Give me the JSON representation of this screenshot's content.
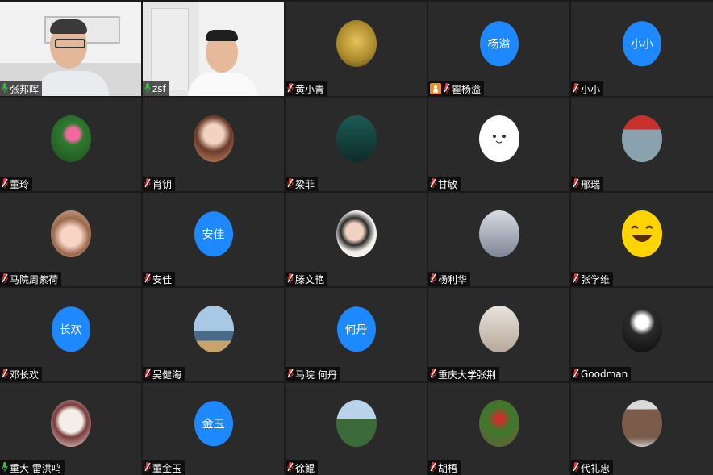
{
  "app": {
    "view": "gallery"
  },
  "colors": {
    "tile_bg": "#2a2a2a",
    "avatar_blue": "#1e88ff",
    "active_border": "#39b54a",
    "mic_muted": "#e53935",
    "mic_on": "#39b54a"
  },
  "participants": [
    {
      "name": "张邦晖",
      "type": "video",
      "mic": "on",
      "active": true,
      "avatar_icon": "man-with-glasses-video"
    },
    {
      "name": "zsf",
      "type": "video",
      "mic": "on",
      "avatar_icon": "man-video"
    },
    {
      "name": "黄小青",
      "type": "image",
      "mic": "muted",
      "avatar_icon": "golden-heart-avatar"
    },
    {
      "name": "瞿杨溢",
      "type": "text",
      "avatar_text": "杨溢",
      "mic": "muted",
      "hand_raised": true
    },
    {
      "name": "小小",
      "type": "text",
      "avatar_text": "小小",
      "mic": "muted"
    },
    {
      "name": "董玲",
      "type": "image",
      "mic": "muted",
      "avatar_icon": "lotus-flower-avatar"
    },
    {
      "name": "肖钥",
      "type": "image",
      "mic": "muted",
      "avatar_icon": "anime-girl-avatar"
    },
    {
      "name": " 梁菲",
      "type": "image",
      "mic": "muted",
      "avatar_icon": "girl-black-dress-avatar"
    },
    {
      "name": "甘敏",
      "type": "image",
      "mic": "muted",
      "avatar_icon": "white-blob-avatar"
    },
    {
      "name": "邢瑞",
      "type": "image",
      "mic": "muted",
      "avatar_icon": "umbrella-street-avatar"
    },
    {
      "name": "马院周紫荷",
      "type": "image",
      "mic": "muted",
      "avatar_icon": "cat-ears-girl-avatar"
    },
    {
      "name": "安佳",
      "type": "text",
      "avatar_text": "安佳",
      "mic": "muted"
    },
    {
      "name": "滕文艳",
      "type": "image",
      "mic": "muted",
      "avatar_icon": "child-with-heart-avatar"
    },
    {
      "name": "杨利华",
      "type": "image",
      "mic": "muted",
      "avatar_icon": "girl-portrait-avatar"
    },
    {
      "name": "张学维",
      "type": "image",
      "mic": "muted",
      "avatar_icon": "laughing-emoji-avatar"
    },
    {
      "name": "邓长欢",
      "type": "text",
      "avatar_text": "长欢",
      "mic": "muted"
    },
    {
      "name": "吴健海",
      "type": "image",
      "mic": "muted",
      "avatar_icon": "man-at-seaside-avatar"
    },
    {
      "name": "马院 何丹",
      "type": "text",
      "avatar_text": "何丹",
      "mic": "muted"
    },
    {
      "name": "重庆大学张荆",
      "type": "image",
      "mic": "muted",
      "avatar_icon": "girl-in-alley-avatar"
    },
    {
      "name": "Goodman",
      "type": "image",
      "mic": "muted",
      "avatar_icon": "white-rose-avatar"
    },
    {
      "name": "重大  雷洪鸣",
      "type": "image",
      "mic": "on",
      "avatar_icon": "ink-painting-avatar"
    },
    {
      "name": "董金玉",
      "type": "text",
      "avatar_text": "金玉",
      "mic": "muted"
    },
    {
      "name": "徐鲲",
      "type": "image",
      "mic": "muted",
      "avatar_icon": "mountain-landscape-avatar"
    },
    {
      "name": "胡梧",
      "type": "image",
      "mic": "muted",
      "avatar_icon": "fruit-tree-avatar"
    },
    {
      "name": "代礼忠",
      "type": "image",
      "mic": "muted",
      "avatar_icon": "group-figures-avatar"
    }
  ]
}
